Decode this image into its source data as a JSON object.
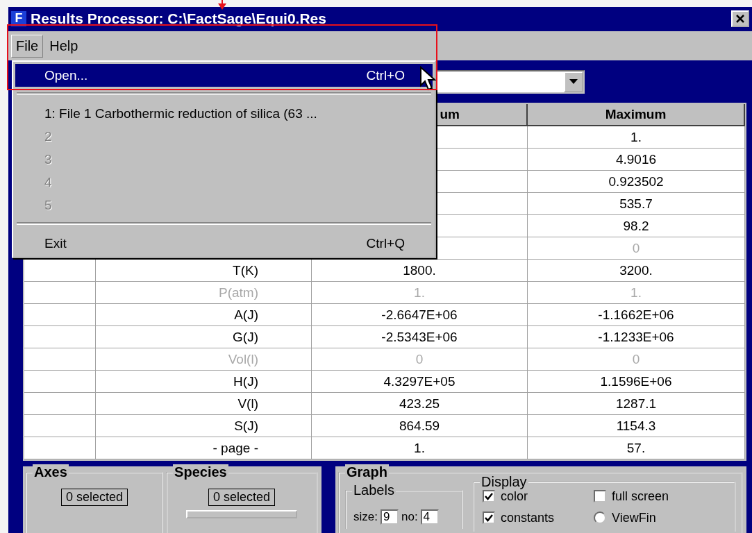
{
  "window": {
    "icon_letter": "F",
    "title": "Results Processor: C:\\FactSage\\Equi0.Res"
  },
  "menu_bar": [
    {
      "label": "File",
      "selected": true
    },
    {
      "label": "Help",
      "selected": false
    }
  ],
  "file_menu": [
    {
      "kind": "item",
      "label": "Open...",
      "shortcut": "Ctrl+O",
      "selected": true,
      "disabled": false
    },
    {
      "kind": "separator"
    },
    {
      "kind": "item",
      "label": "1: File 1  Carbothermic reduction of silica (63  ...",
      "selected": false,
      "disabled": false
    },
    {
      "kind": "item",
      "label": "2",
      "selected": false,
      "disabled": true
    },
    {
      "kind": "item",
      "label": "3",
      "selected": false,
      "disabled": true
    },
    {
      "kind": "item",
      "label": "4",
      "selected": false,
      "disabled": true
    },
    {
      "kind": "item",
      "label": "5",
      "selected": false,
      "disabled": true
    },
    {
      "kind": "separator"
    },
    {
      "kind": "item",
      "label": "Exit",
      "shortcut": "Ctrl+Q",
      "selected": false,
      "disabled": false
    }
  ],
  "table": {
    "columns": [
      {
        "label": "um"
      },
      {
        "label": "Maximum"
      }
    ],
    "rows": [
      {
        "maximum": "1.",
        "disabled": false
      },
      {
        "maximum": "4.9016",
        "disabled": false
      },
      {
        "maximum": "0.923502",
        "disabled": false
      },
      {
        "maximum": "535.7",
        "disabled": false
      },
      {
        "maximum": "98.2",
        "disabled": false
      },
      {
        "maximum": "0",
        "disabled": true
      },
      {
        "name": "T(K)",
        "minimum": "1800.",
        "maximum": "3200.",
        "disabled": false
      },
      {
        "name": "P(atm)",
        "minimum": "1.",
        "maximum": "1.",
        "disabled": true
      },
      {
        "name": "A(J)",
        "minimum": "-2.6647E+06",
        "maximum": "-1.1662E+06",
        "disabled": false
      },
      {
        "name": "G(J)",
        "minimum": "-2.5343E+06",
        "maximum": "-1.1233E+06",
        "disabled": false
      },
      {
        "name": "Vol(l)",
        "minimum": "0",
        "maximum": "0",
        "disabled": true
      },
      {
        "name": "H(J)",
        "minimum": "4.3297E+05",
        "maximum": "1.1596E+06",
        "disabled": false
      },
      {
        "name": "V(l)",
        "minimum": "423.25",
        "maximum": "1287.1",
        "disabled": false
      },
      {
        "name": "S(J)",
        "minimum": "864.59",
        "maximum": "1154.3",
        "disabled": false
      },
      {
        "name": "- page -",
        "minimum": "1.",
        "maximum": "57.",
        "disabled": false
      }
    ]
  },
  "axes": {
    "title": "Axes",
    "count": "0 selected"
  },
  "species": {
    "title": "Species",
    "count": "0 selected"
  },
  "graph": {
    "title": "Graph",
    "labels": {
      "title": "Labels",
      "size_label": "size:",
      "size": "9",
      "no_label": "no:",
      "no": "4"
    },
    "display": {
      "title": "Display",
      "options": [
        {
          "kind": "checkbox",
          "label": "color",
          "checked": true
        },
        {
          "kind": "checkbox",
          "label": "full screen",
          "checked": false
        },
        {
          "kind": "checkbox",
          "label": "constants",
          "checked": true
        },
        {
          "kind": "radio",
          "label": "ViewFin",
          "checked": false
        }
      ]
    }
  }
}
